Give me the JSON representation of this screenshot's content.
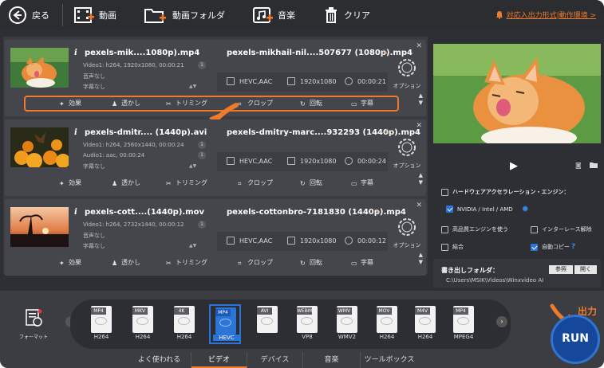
{
  "toolbar": {
    "back": "戻る",
    "video": "動画",
    "video_folder": "動画フォルダ",
    "audio": "音楽",
    "clear": "クリア",
    "notice": "対応入出力形式|動作環境 >"
  },
  "files": [
    {
      "source_name": "pexels-mik....1080p).mp4",
      "video_meta": "Video1: h264, 1920x1080, 00:00:21",
      "audio_meta": "音声なし",
      "subtitle_meta": "字幕なし",
      "video_count": "1",
      "output_name": "pexels-mikhail-nil....507677 (1080p).mp4",
      "codec": "HEVC,AAC",
      "resolution": "1920x1080",
      "duration": "00:00:21"
    },
    {
      "source_name": "pexels-dmitr.... (1440p).avi",
      "video_meta": "Video1: h264, 2560x1440, 00:00:24",
      "audio_meta": "Audio1: aac, 00:00:24",
      "subtitle_meta": "字幕なし",
      "video_count": "1",
      "audio_count": "1",
      "output_name": "pexels-dmitry-marc....932293 (1440p).mp4",
      "codec": "HEVC,AAC",
      "resolution": "1920x1080",
      "duration": "00:00:24"
    },
    {
      "source_name": "pexels-cott....(1440p).mov",
      "video_meta": "Video1: h264, 2732x1440, 00:00:12",
      "audio_meta": "音声なし",
      "subtitle_meta": "字幕なし",
      "video_count": "1",
      "output_name": "pexels-cottonbro-7181830 (1440p).mp4",
      "codec": "HEVC,AAC",
      "resolution": "1920x1080",
      "duration": "00:00:12"
    }
  ],
  "row_actions": {
    "effect": "効果",
    "watermark": "透かし",
    "trim": "トリミング",
    "crop": "クロップ",
    "rotate": "回転",
    "subtitle": "字幕",
    "option": "オプション"
  },
  "options": {
    "hw_accel": "ハードウェアアクセラレーション・エンジン：",
    "gpu": "NVIDIA / Intel / AMD",
    "hq_engine": "高品質エンジンを使う",
    "deinterlace": "インターレース解除",
    "merge": "結合",
    "auto_copy": "自動コピー",
    "auto_copy_help": "?"
  },
  "output_folder": {
    "label": "書き出しフォルダ：",
    "browse": "参照",
    "open": "開く",
    "path": "C:\\Users\\MSIK\\Videos\\Winxvideo AI"
  },
  "formats": {
    "label": "フォーマット",
    "items": [
      {
        "top": "MP4",
        "sub": "H264"
      },
      {
        "top": "MKV",
        "sub": "H264"
      },
      {
        "top": "4K",
        "sub": "H264"
      },
      {
        "top": "MP4",
        "sub": "HEVC"
      },
      {
        "top": "AVI",
        "sub": ""
      },
      {
        "top": "WEBM",
        "sub": "VP8"
      },
      {
        "top": "WMV",
        "sub": "WMV2"
      },
      {
        "top": "MOV",
        "sub": "H264"
      },
      {
        "top": "M4V",
        "sub": "H264"
      },
      {
        "top": "MP4",
        "sub": "MPEG4"
      }
    ],
    "selected_index": 3
  },
  "tabs": [
    "よく使われる",
    "ビデオ",
    "デバイス",
    "音楽",
    "ツールボックス"
  ],
  "active_tab": 1,
  "run": {
    "label": "RUN",
    "hint": "出力"
  },
  "colors": {
    "accent": "#f07a2a",
    "selection": "#2b74d8"
  }
}
